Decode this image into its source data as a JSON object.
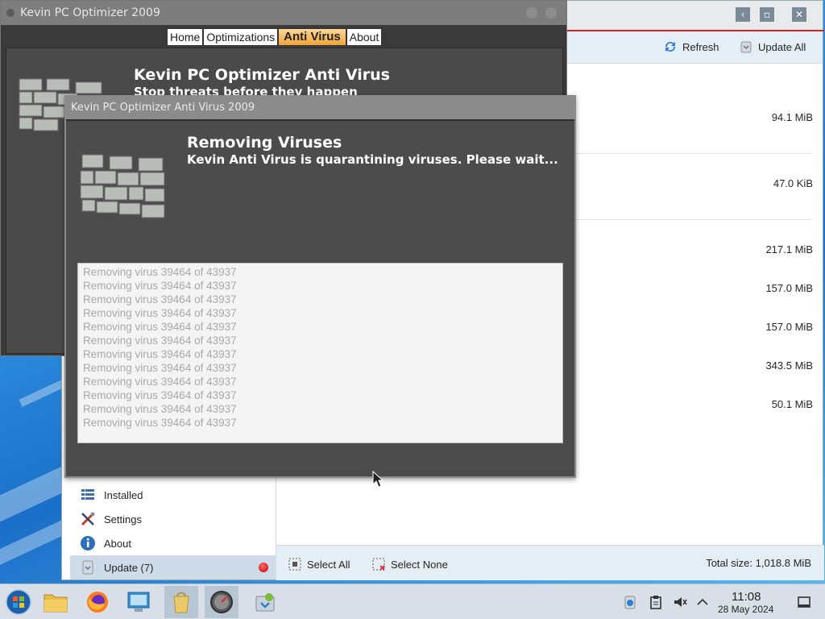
{
  "updater": {
    "toolbar": {
      "refresh_label": "Refresh",
      "update_all_label": "Update All"
    },
    "sizes": [
      "94.1 MiB",
      "47.0 KiB",
      "217.1 MiB",
      "157.0 MiB",
      "157.0 MiB",
      "343.5 MiB",
      "50.1 MiB"
    ],
    "sidebar": {
      "items": [
        {
          "label": "Installed",
          "icon": "list-icon"
        },
        {
          "label": "Settings",
          "icon": "tools-icon"
        },
        {
          "label": "About",
          "icon": "info-icon"
        },
        {
          "label": "Update (7)",
          "icon": "update-icon"
        }
      ]
    },
    "footer": {
      "select_all_label": "Select All",
      "select_none_label": "Select None",
      "total_size": "Total size: 1,018.8 MiB"
    }
  },
  "optimizer": {
    "title": "Kevin PC Optimizer 2009",
    "nav": [
      "Home",
      "Optimizations",
      "Anti Virus",
      "About"
    ],
    "active_tab": "Anti Virus",
    "heading": "Kevin PC Optimizer Anti Virus",
    "subheading": "Stop threats before they happen"
  },
  "antivirus": {
    "title": "Kevin PC Optimizer Anti Virus 2009",
    "heading": "Removing Viruses",
    "subheading": "Kevin Anti Virus is quarantining viruses. Please wait...",
    "log": [
      "Removing virus 39464 of 43937",
      "Removing virus 39464 of 43937",
      "Removing virus 39464 of 43937",
      "Removing virus 39464 of 43937",
      "Removing virus 39464 of 43937",
      "Removing virus 39464 of 43937",
      "Removing virus 39464 of 43937",
      "Removing virus 39464 of 43937",
      "Removing virus 39464 of 43937",
      "Removing virus 39464 of 43937",
      "Removing virus 39464 of 43937",
      "Removing virus 39464 of 43937"
    ]
  },
  "taskbar": {
    "apps": [
      "start-icon",
      "file-manager-icon",
      "firefox-icon",
      "system-settings-icon",
      "shopping-bag-icon",
      "kevin-optimizer-icon",
      "software-updater-icon"
    ],
    "time": "11:08",
    "date": "28 May 2024"
  },
  "colors": {
    "active_tab": "#f0a33a",
    "badge": "#c80000",
    "desktop": "#2f8fe0"
  }
}
